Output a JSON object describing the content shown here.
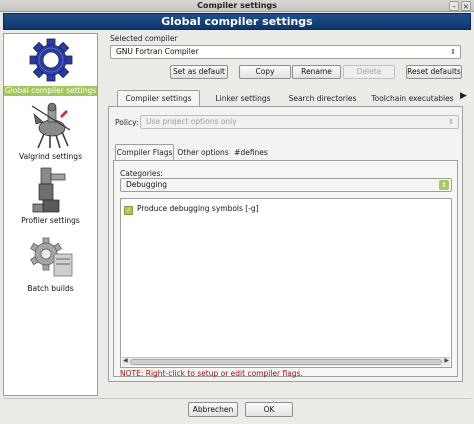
{
  "window": {
    "title": "Compiler settings",
    "banner": "Global compiler settings"
  },
  "sidebar": {
    "items": [
      {
        "label": "Global compiler settings",
        "active": true
      },
      {
        "label": "Valgrind settings"
      },
      {
        "label": "Profiler settings"
      },
      {
        "label": "Batch builds"
      }
    ]
  },
  "compiler": {
    "selected_label": "Selected compiler",
    "selected_value": "GNU Fortran Compiler",
    "buttons": {
      "set_default": "Set as default",
      "copy": "Copy",
      "rename": "Rename",
      "delete": "Delete",
      "reset": "Reset defaults"
    }
  },
  "tabs": [
    "Compiler settings",
    "Linker settings",
    "Search directories",
    "Toolchain executables"
  ],
  "policy": {
    "label": "Policy:",
    "value": "Use project options only"
  },
  "subtabs": [
    "Compiler Flags",
    "Other options",
    "#defines"
  ],
  "categories": {
    "label": "Categories:",
    "value": "Debugging"
  },
  "flags": [
    {
      "label": "Produce debugging symbols  [-g]",
      "checked": true
    }
  ],
  "note": "NOTE: Right-click to setup or edit compiler flags.",
  "footer": {
    "cancel": "Abbrechen",
    "ok": "OK"
  },
  "colors": {
    "banner": "#1d4f8b",
    "accent_green": "#a8c85e",
    "note_red": "#a01010"
  }
}
